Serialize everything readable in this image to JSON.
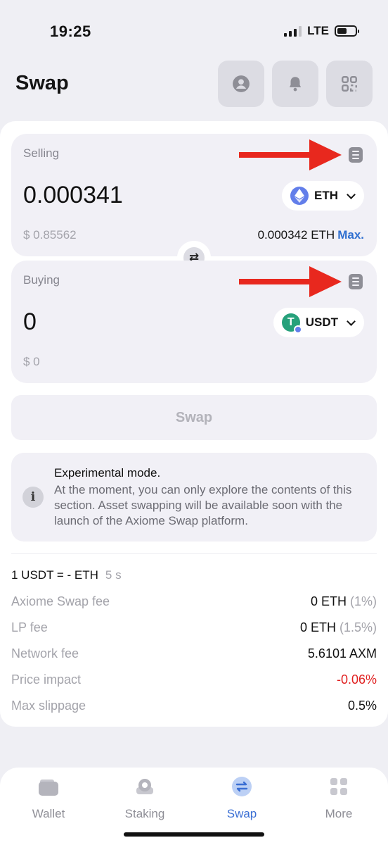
{
  "status": {
    "time": "19:25",
    "network": "LTE"
  },
  "header": {
    "title": "Swap",
    "icons": [
      "profile-icon",
      "bell-icon",
      "qr-code-icon"
    ]
  },
  "selling": {
    "label": "Selling",
    "amount": "0.000341",
    "fiat": "$ 0.85562",
    "token": "ETH",
    "balance": "0.000342 ETH",
    "max_label": "Max."
  },
  "buying": {
    "label": "Buying",
    "amount": "0",
    "fiat": "$ 0",
    "token": "USDT"
  },
  "swap_button": "Swap",
  "notice": {
    "title": "Experimental mode.",
    "body": "At the moment, you can only explore the contents of this section. Asset swapping will be available soon with the launch of the Axiome Swap platform."
  },
  "rate": {
    "text": "1 USDT = - ETH",
    "timer": "5 s"
  },
  "details": {
    "swap_fee": {
      "label": "Axiome Swap fee",
      "value": "0 ETH",
      "pct": "(1%)"
    },
    "lp_fee": {
      "label": "LP fee",
      "value": "0 ETH",
      "pct": "(1.5%)"
    },
    "network_fee": {
      "label": "Network fee",
      "value": "5.6101 AXM"
    },
    "price_impact": {
      "label": "Price impact",
      "value": "-0.06%"
    },
    "max_slippage": {
      "label": "Max slippage",
      "value": "0.5%"
    }
  },
  "nav": {
    "wallet": "Wallet",
    "staking": "Staking",
    "swap": "Swap",
    "more": "More",
    "active": "swap"
  },
  "colors": {
    "accent": "#3b6fd4",
    "negative": "#e02020",
    "annotation_arrow": "#e8281e"
  }
}
